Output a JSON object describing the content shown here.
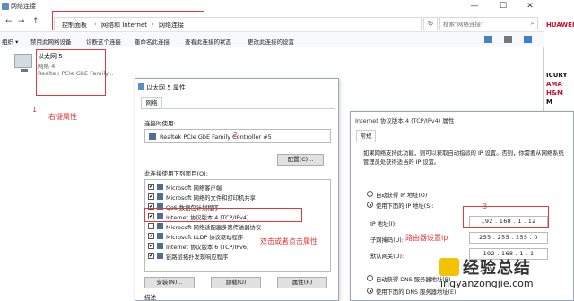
{
  "window": {
    "title": "网络连接",
    "controls": [
      "—",
      "☐",
      "✕"
    ]
  },
  "nav": {
    "back": "←",
    "forward": "→",
    "up": "↑",
    "crumbs": [
      "控制面板",
      "网络和 Internet",
      "网络连接"
    ],
    "refresh": "↻",
    "search_placeholder": "搜索\"网络连接\""
  },
  "toolbar": {
    "items": [
      "组织 ▾",
      "禁用此网络设备",
      "诊断这个连接",
      "重命名此连接",
      "查看此连接的状态",
      "更改此连接的设置"
    ]
  },
  "adapter": {
    "name": "以太网 5",
    "network": "网络 4",
    "device": "Realtek PCIe GbE Family..."
  },
  "annotations": {
    "step1_num": "1",
    "step1_text": "右键属性",
    "step2_num": "2",
    "step2_text": "双击或者点击属性",
    "step3_num": "3",
    "step3_text": "路由器设置ip"
  },
  "props_dialog": {
    "title": "以太网 5 属性",
    "tab": "网络",
    "connect_label": "连接时使用:",
    "adapter_name": "Realtek PCIe GbE Family Controller #5",
    "configure_btn": "配置(C)...",
    "items_label": "此连接使用下列项目(O):",
    "items": [
      {
        "checked": "✔",
        "label": "Microsoft 网络客户端"
      },
      {
        "checked": "✔",
        "label": "Microsoft 网络的文件和打印机共享"
      },
      {
        "checked": "✔",
        "label": "QoS 数据包计划程序"
      },
      {
        "checked": "✔",
        "label": "Internet 协议版本 4 (TCP/IPv4)"
      },
      {
        "checked": "",
        "label": "Microsoft 网络适配器多路传送器协议"
      },
      {
        "checked": "✔",
        "label": "Microsoft LLDP 协议驱动程序"
      },
      {
        "checked": "✔",
        "label": "Internet 协议版本 6 (TCP/IPv6)"
      },
      {
        "checked": "✔",
        "label": "链路层拓扑发现响应程序"
      }
    ],
    "install_btn": "安装(N)...",
    "uninstall_btn": "卸载(U)",
    "properties_btn": "属性(R)",
    "desc_label": "描述"
  },
  "ipv4_dialog": {
    "title": "Internet 协议版本 4 (TCP/IPv4) 属性",
    "tab": "常规",
    "desc": "如果网络支持此功能，则可以获取自动指派的 IP 设置。否则，你需要从网络系统管理员处获得适当的 IP 设置。",
    "auto_ip": "自动获得 IP 地址(O)",
    "manual_ip": "使用下面的 IP 地址(S):",
    "ip_label": "IP 地址(I):",
    "ip_value": "192 . 168 .  1  .  12",
    "mask_label": "子网掩码(U):",
    "mask_value": "255 . 255 . 255 .  0",
    "gateway_label": "默认网关(D):",
    "gateway_value": "192 . 168 .  1  .  1",
    "auto_dns": "自动获得 DNS 服务器地址(B)",
    "manual_dns": "使用下面的 DNS 服务器地址(E):"
  },
  "side_ads": [
    "HUAWEI",
    "ICURY",
    "AMA",
    "H&M",
    "M"
  ],
  "watermark": {
    "big": "经验总结",
    "small": "jingyanzongjie.com"
  }
}
